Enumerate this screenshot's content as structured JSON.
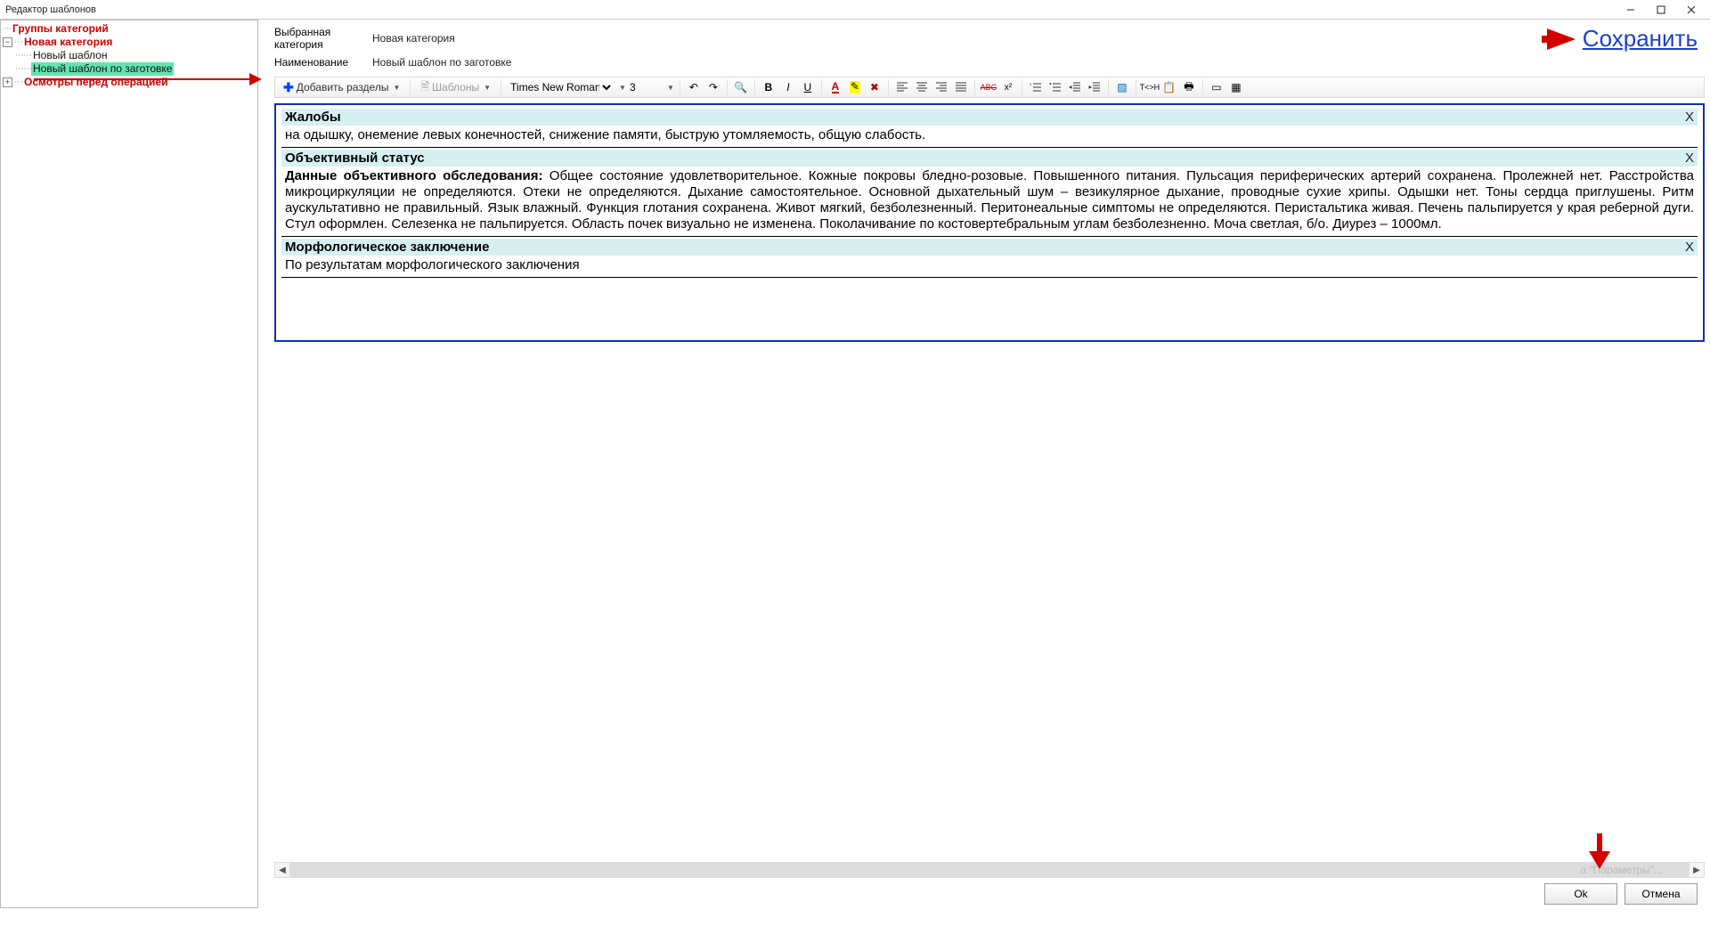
{
  "window": {
    "title": "Редактор шаблонов"
  },
  "tree": {
    "root": "Группы категорий",
    "cat": "Новая категория",
    "child1": "Новый шаблон",
    "child2": "Новый шаблон по заготовке",
    "node3": "Осмотры перед операцией"
  },
  "meta": {
    "cat_label": "Выбранная категория",
    "cat_value": "Новая категория",
    "name_label": "Наименование",
    "name_value": "Новый шаблон по заготовке"
  },
  "save_link": "Сохранить",
  "toolbar": {
    "add_sections": "Добавить разделы",
    "templates": "Шаблоны",
    "font": "Times New Roman",
    "size": "3",
    "txh": "T<>H"
  },
  "sections": {
    "complaints": {
      "title": "Жалобы",
      "text": "на одышку, онемение левых конечностей, снижение памяти, быструю утомляемость, общую слабость."
    },
    "objective": {
      "title": "Объективный статус",
      "lead": "Данные объективного обследования:",
      "text": " Общее состояние удовлетворительное. Кожные покровы бледно-розовые. Повышенного питания. Пульсация периферических артерий сохранена. Пролежней нет. Расстройства микроциркуляции не определяются. Отеки не определяются. Дыхание самостоятельное. Основной дыхательный шум – везикулярное дыхание, проводные сухие хрипы. Одышки нет. Тоны сердца приглушены. Ритм аускультативно не правильный. Язык влажный. Функция глотания сохранена. Живот мягкий, безболезненный. Перитонеальные симптомы не определяются. Перистальтика живая. Печень пальпируется у края реберной дуги. Стул оформлен. Селезенка не пальпируется. Область почек визуально не изменена. Поколачивание по костовертебральным углам безболезненно. Моча светлая, б/о. Диурез – 1000мл."
    },
    "morph": {
      "title": "Морфологическое заключение",
      "text": "По результатам морфологического заключения"
    },
    "close": "X"
  },
  "hscroll_hint": "а \"Параметры\"...",
  "buttons": {
    "ok": "Ok",
    "cancel": "Отмена"
  }
}
